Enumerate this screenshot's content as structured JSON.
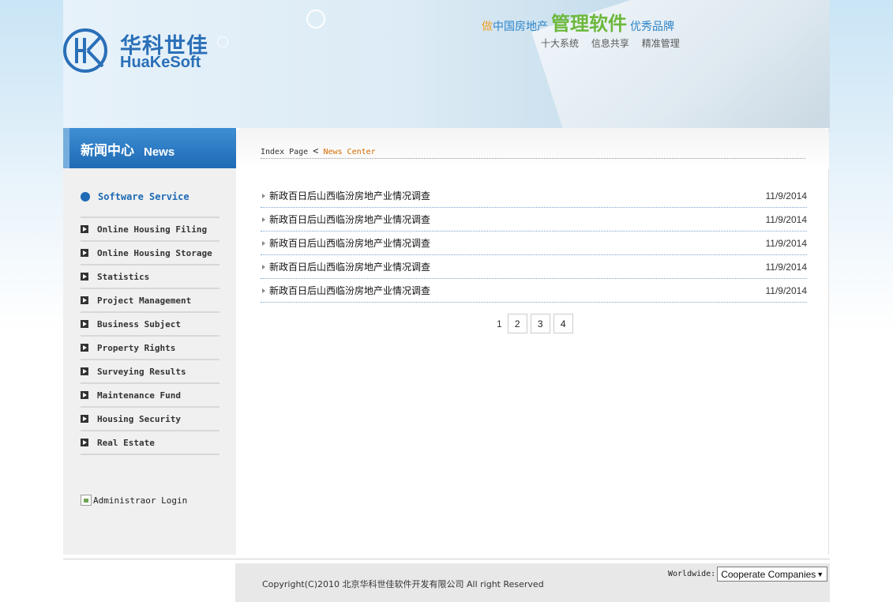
{
  "header": {
    "logo_cn": "华科世佳",
    "logo_en": "HuaKeSoft",
    "slogan": {
      "part1": "做",
      "part2": "中国房地产",
      "part3": "管理软件",
      "part4": "优秀品牌"
    },
    "features": [
      "十大系统",
      "信息共享",
      "精准管理"
    ]
  },
  "sidebar": {
    "title_cn": "新闻中心",
    "title_en": "News",
    "section": "Software Service",
    "items": [
      "Online Housing Filing",
      "Online Housing Storage",
      "Statistics",
      "Project Management",
      "Business Subject",
      "Property Rights",
      "Surveying Results",
      "Maintenance Fund",
      "Housing Security",
      "Real Estate"
    ],
    "admin_login": "Administraor Login"
  },
  "breadcrumb": {
    "home": "Index Page",
    "separator": "<",
    "current": "News Center"
  },
  "news": [
    {
      "title": "新政百日后山西临汾房地产业情况调查",
      "date": "11/9/2014"
    },
    {
      "title": "新政百日后山西临汾房地产业情况调查",
      "date": "11/9/2014"
    },
    {
      "title": "新政百日后山西临汾房地产业情况调查",
      "date": "11/9/2014"
    },
    {
      "title": "新政百日后山西临汾房地产业情况调查",
      "date": "11/9/2014"
    },
    {
      "title": "新政百日后山西临汾房地产业情况调查",
      "date": "11/9/2014"
    }
  ],
  "pagination": {
    "current": "1",
    "pages": [
      "2",
      "3",
      "4"
    ]
  },
  "footer": {
    "copyright": "Copyright(C)2010 北京华科世佳软件开发有限公司  All right Reserved",
    "worldwide_label": "Worldwide:",
    "worldwide_selected": "Cooperate Companies"
  },
  "colors": {
    "brand_blue": "#2a6fb8",
    "accent_orange": "#d86a00",
    "accent_green": "#6cb83b"
  },
  "icons": {
    "logo": "hk-logo-icon",
    "bullet": "play-bullet-icon",
    "dot": "circle-dot-icon",
    "news_arrow": "triangle-right-icon",
    "broken_image": "broken-image-icon",
    "caret": "caret-down-icon"
  }
}
